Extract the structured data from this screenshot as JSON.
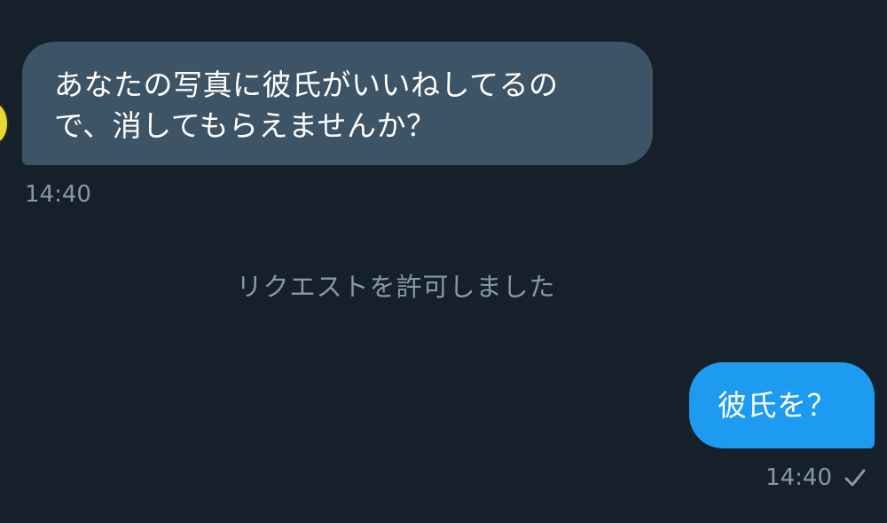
{
  "messages": {
    "incoming": {
      "line1": "あなたの写真に彼氏がいいねしてるの",
      "line2": "で、消してもらえませんか？",
      "time": "14:40"
    },
    "system": {
      "text": "リクエストを許可しました"
    },
    "outgoing": {
      "text": "彼氏を？",
      "time": "14:40",
      "status_icon": "checkmark-icon"
    }
  },
  "colors": {
    "background": "#16202b",
    "incoming_bubble": "#3d5466",
    "outgoing_bubble": "#1d9bf0",
    "muted_text": "#8899a6",
    "message_text": "#ffffff"
  }
}
